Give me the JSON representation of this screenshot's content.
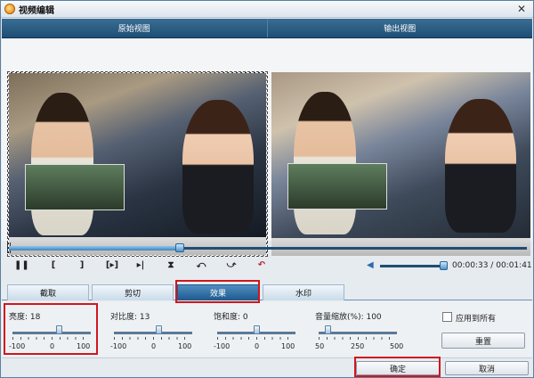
{
  "window": {
    "title": "视频编辑",
    "close_glyph": "✕"
  },
  "headers": {
    "original": "原始视图",
    "output": "输出视图"
  },
  "seek": {
    "progress_percent": 33
  },
  "controls": {
    "pause": "❚❚",
    "mark_in": "[",
    "mark_out": "]",
    "frame_step": "[▸]",
    "play_segment": "▸|",
    "flip": "⧗",
    "rotate_left": "⤺",
    "rotate_right": "⤻",
    "undo": "↶",
    "volume_icon": "◀",
    "time_current": "00:00:33",
    "time_separator": "/",
    "time_total": "00:01:41"
  },
  "tabs": [
    {
      "label": "截取"
    },
    {
      "label": "剪切"
    },
    {
      "label": "效果",
      "active": true
    },
    {
      "label": "水印"
    }
  ],
  "sliders": {
    "brightness": {
      "label": "亮度:",
      "value": "18",
      "min": "-100",
      "mid": "0",
      "max": "100",
      "level": 0.59
    },
    "contrast": {
      "label": "对比度:",
      "value": "13",
      "min": "-100",
      "mid": "0",
      "max": "100",
      "level": 0.565
    },
    "saturation": {
      "label": "饱和度:",
      "value": "0",
      "min": "-100",
      "mid": "0",
      "max": "100",
      "level": 0.5
    },
    "volume": {
      "label": "音量缩放(%):",
      "value": "100",
      "min": "50",
      "mid": "250",
      "max": "500",
      "level": 0.11
    }
  },
  "options": {
    "apply_all": "应用到所有",
    "reset": "重置"
  },
  "footer": {
    "ok": "确定",
    "cancel": "取消"
  },
  "colors": {
    "accent": "#1d5a8d",
    "highlight": "#d0161e"
  }
}
